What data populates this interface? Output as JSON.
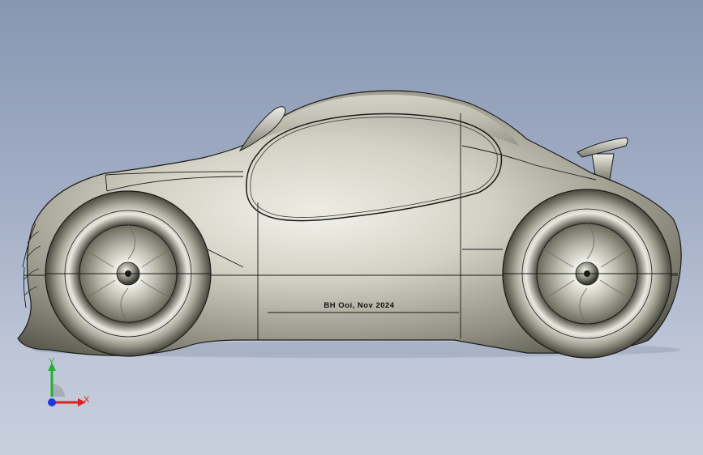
{
  "viewport": {
    "background_top": "#8896b2",
    "background_bottom": "#c8cfdd"
  },
  "model": {
    "signature": "BH Ooi, Nov 2024",
    "body_color": "#c9c8bc",
    "edge_color": "#1a1a1a"
  },
  "triad": {
    "x_label": "X",
    "y_label": "Y",
    "x_color": "#e0201e",
    "y_color": "#22b030",
    "z_color": "#1e3adc"
  }
}
